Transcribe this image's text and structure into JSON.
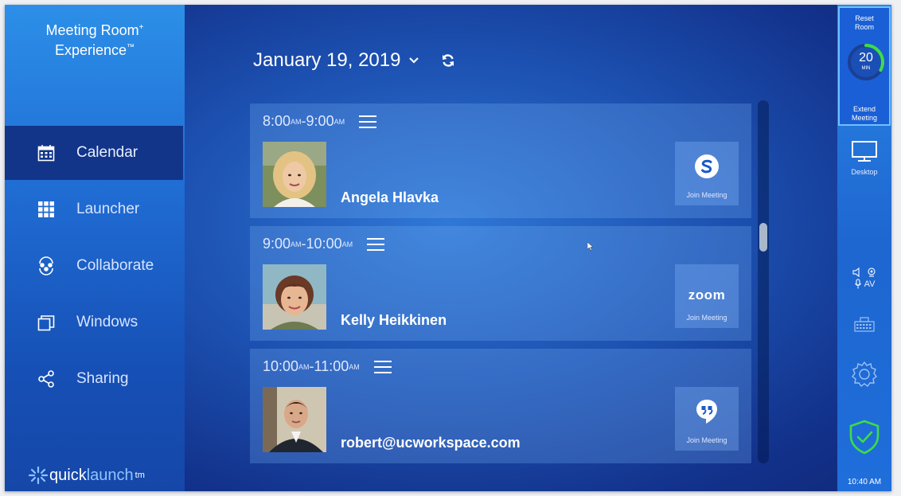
{
  "brand": {
    "line1": "Meeting Room",
    "line1_sup": "+",
    "line2": "Experience",
    "line2_sup": "™"
  },
  "nav": [
    {
      "label": "Calendar",
      "icon": "calendar-icon",
      "active": true
    },
    {
      "label": "Launcher",
      "icon": "grid-icon",
      "active": false
    },
    {
      "label": "Collaborate",
      "icon": "collaborate-icon",
      "active": false
    },
    {
      "label": "Windows",
      "icon": "windows-icon",
      "active": false
    },
    {
      "label": "Sharing",
      "icon": "share-icon",
      "active": false
    }
  ],
  "logo": {
    "part1": "quick",
    "part2": "launch",
    "sup": "tm"
  },
  "header": {
    "date": "January 19, 2019"
  },
  "meetings": [
    {
      "start": "8:00",
      "start_sup": "AM",
      "end": "9:00",
      "end_sup": "AM",
      "name": "Angela Hlavka",
      "service": "skype",
      "join_label": "Join Meeting"
    },
    {
      "start": "9:00",
      "start_sup": "AM",
      "end": "10:00",
      "end_sup": "AM",
      "name": "Kelly Heikkinen",
      "service": "zoom",
      "service_text": "zoom",
      "join_label": "Join Meeting"
    },
    {
      "start": "10:00",
      "start_sup": "AM",
      "end": "11:00",
      "end_sup": "AM",
      "name": "robert@ucworkspace.com",
      "service": "hangouts",
      "join_label": "Join Meeting"
    }
  ],
  "rail": {
    "reset_label_1": "Reset",
    "reset_label_2": "Room",
    "timer_value": "20",
    "timer_unit": "MIN",
    "timer_fraction": 0.33,
    "extend_label_1": "Extend",
    "extend_label_2": "Meeting",
    "desktop_label": "Desktop",
    "av_label": "AV",
    "time": "10:40 AM"
  },
  "colors": {
    "accent_green": "#3ddc4a",
    "active_nav": "#12358a"
  }
}
